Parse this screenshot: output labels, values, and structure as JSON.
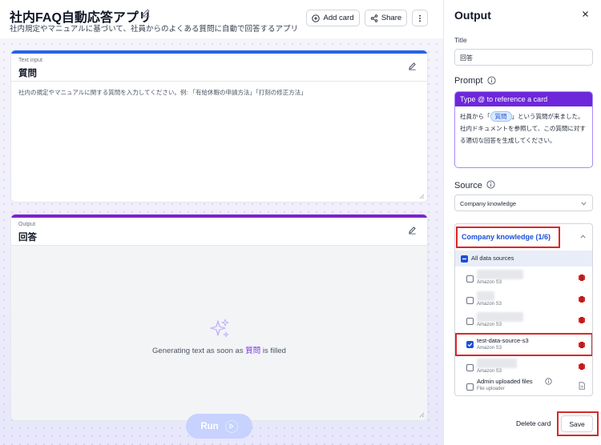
{
  "header": {
    "title": "社内FAQ自動応答アプリ",
    "subtitle": "社内規定やマニュアルに基づいて、社員からのよくある質問に自動で回答するアプリ",
    "add_card_label": "Add card",
    "share_label": "Share"
  },
  "input_card": {
    "kind": "Text input",
    "title": "質問",
    "placeholder": "社内の規定やマニュアルに関する質問を入力してください。例: 「有給休暇の申請方法」「打刻の修正方法」"
  },
  "output_card": {
    "kind": "Output",
    "title": "回答",
    "generating_prefix": "Generating text as soon as ",
    "generating_ref": "質問",
    "generating_suffix": " is filled"
  },
  "run_label": "Run",
  "panel": {
    "title": "Output",
    "title_label": "Title",
    "title_value": "回答",
    "prompt_label": "Prompt",
    "prompt_hint": "Type @ to reference a card",
    "prompt_before": "社員から「",
    "prompt_chip": "質問",
    "prompt_after": "」という質問が来ました。社内ドキュメントを参照して、この質問に対する適切な回答を生成してください。",
    "source_label": "Source",
    "source_value": "Company knowledge",
    "knowledge_header": "Company knowledge (1/6)",
    "all_sources_label": "All data sources",
    "sources": [
      {
        "name": "",
        "type": "Amazon S3",
        "checked": false
      },
      {
        "name": "",
        "type": "Amazon S3",
        "checked": false
      },
      {
        "name": "",
        "type": "Amazon S3",
        "checked": false
      },
      {
        "name": "test-data-source-s3",
        "type": "Amazon S3",
        "checked": true
      },
      {
        "name": "",
        "type": "Amazon S3",
        "checked": false
      },
      {
        "name": "Admin uploaded files",
        "type": "File uploader",
        "checked": false
      }
    ],
    "delete_label": "Delete card",
    "save_label": "Save"
  },
  "colors": {
    "input_accent": "#2563eb",
    "output_accent": "#7e22ce",
    "prompt_header": "#6d28d9",
    "highlight_frame": "#dc2626",
    "s3_icon": "#dc2626"
  }
}
